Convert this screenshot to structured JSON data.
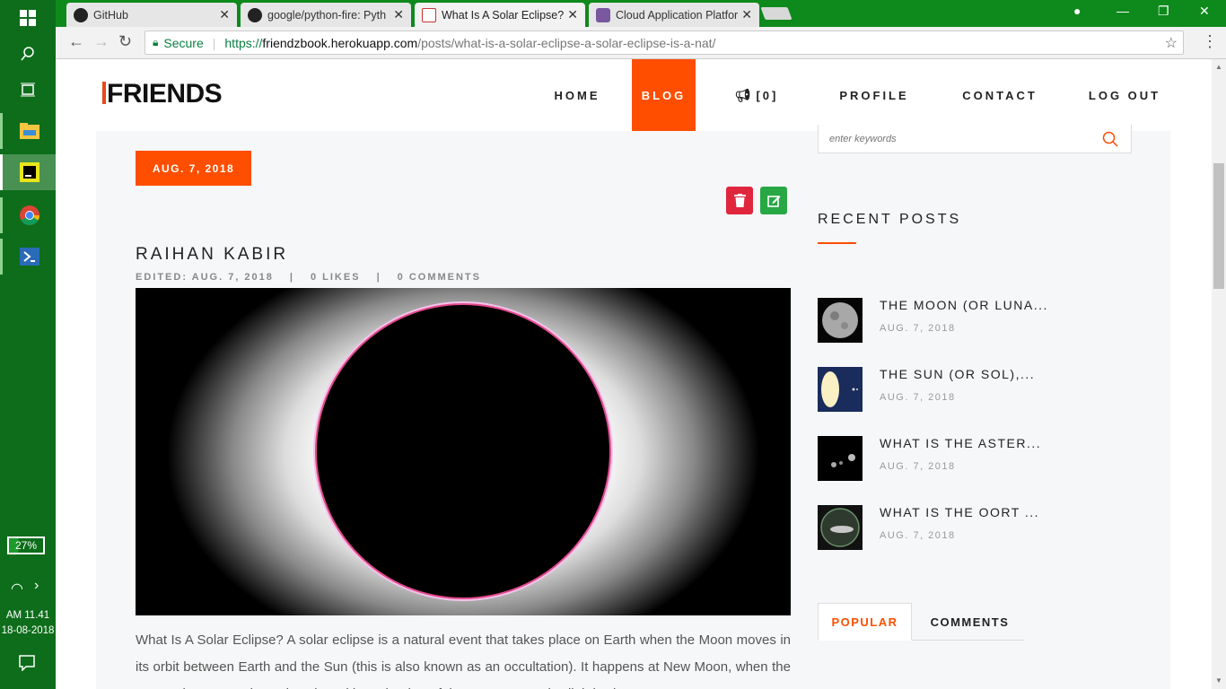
{
  "taskbar": {
    "battery": "27%",
    "time": "AM 11.41",
    "date": "18-08-2018"
  },
  "browser": {
    "tabs": [
      {
        "title": "GitHub"
      },
      {
        "title": "google/python-fire: Pyth"
      },
      {
        "title": "What Is A Solar Eclipse? A"
      },
      {
        "title": "Cloud Application Platfor"
      }
    ],
    "secure_label": "Secure",
    "url_scheme": "https://",
    "url_host": "friendzbook.herokuapp.com",
    "url_path": "/posts/what-is-a-solar-eclipse-a-solar-eclipse-is-a-nat/"
  },
  "site": {
    "logo": "FRIENDS",
    "nav": {
      "home": "HOME",
      "blog": "BLOG",
      "notifications": "[0]",
      "profile": "PROFILE",
      "contact": "CONTACT",
      "logout": "LOG OUT"
    },
    "accent": "#ff4e00"
  },
  "post": {
    "date": "AUG. 7, 2018",
    "author": "RAIHAN KABIR",
    "edited": "EDITED: AUG. 7, 2018",
    "likes": "0 LIKES",
    "comments": "0 COMMENTS",
    "separator": "|",
    "body": "What Is A Solar Eclipse? A solar eclipse is a natural event that takes place on Earth when the Moon moves in its orbit between Earth and the Sun (this is also known as an occultation). It happens at New Moon, when the Sun and Moon are in conjunction with each other. If the Moon was only slightly closer"
  },
  "sidebar": {
    "search_placeholder": "enter keywords",
    "recent_title": "RECENT POSTS",
    "recent_posts": [
      {
        "title": "THE MOON (OR LUNA...",
        "date": "AUG. 7, 2018"
      },
      {
        "title": "THE SUN (OR SOL),...",
        "date": "AUG. 7, 2018"
      },
      {
        "title": "WHAT IS THE ASTER...",
        "date": "AUG. 7, 2018"
      },
      {
        "title": "WHAT IS THE OORT ...",
        "date": "AUG. 7, 2018"
      }
    ],
    "tab_popular": "POPULAR",
    "tab_comments": "COMMENTS"
  }
}
